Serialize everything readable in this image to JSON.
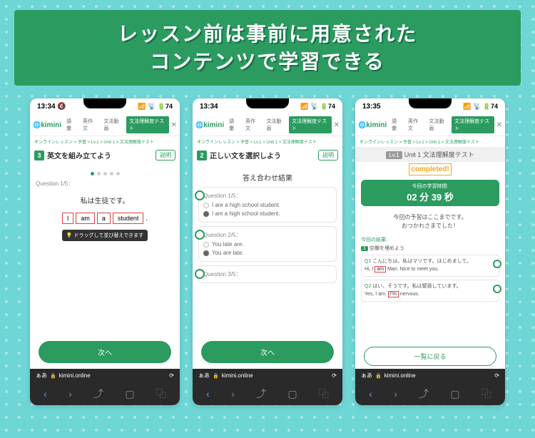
{
  "banner": {
    "line1": "レッスン前は事前に用意された",
    "line2": "コンテンツで学習できる"
  },
  "status": {
    "p1_time": "13:34 🔇",
    "p2_time": "13:34",
    "p3_time": "13:35",
    "icons": "📶 📡 🔋74"
  },
  "app": {
    "logo": "kimini",
    "tabs": [
      "語彙",
      "英作文",
      "文法動画",
      "文法理解度テスト"
    ],
    "close": "✕",
    "breadcrumb": "オンラインレッスン > 予習 > Lv.1 > Unit 1 > 文法理解度テスト"
  },
  "p1": {
    "num": "3",
    "title": "英文を組み立てよう",
    "explain": "説明",
    "qlabel": "Question 1/5：",
    "qtext": "私は生徒です。",
    "words": [
      "I",
      "am",
      "a",
      "student"
    ],
    "period": ".",
    "tip": "💡 ドラッグして並び替えできます",
    "next": "次へ"
  },
  "p2": {
    "num": "2",
    "title": "正しい文を選択しよう",
    "explain": "説明",
    "result_title": "答え合わせ結果",
    "q1_label": "Question 1/5：",
    "q1_opt1": "I are a high school student.",
    "q1_opt2": "I am a high school student.",
    "q2_label": "Question 2/5：",
    "q2_opt1": "You late are.",
    "q2_opt2": "You are late.",
    "q3_label": "Question 3/5：",
    "next": "次へ"
  },
  "p3": {
    "lv": "Lv.1",
    "lvtitle": "Unit 1 文法理解度テスト",
    "completed": "completed!",
    "timer_label": "今回の学習時間:",
    "timer_val": "02 分 39 秒",
    "msg1": "今回の予習はここまでです。",
    "msg2": "おつかれさまでした！",
    "reslabel": "今回の結果:",
    "s1_num": "1",
    "s1_title": "空欄を埋めよう",
    "q1_n": "Q1",
    "q1_jp": "こんにちは。私はマリです。はじめまして。",
    "q1_en_pre": "Hi, I",
    "q1_en_ans": "am",
    "q1_en_post": "Mari. Nice to meet you.",
    "q2_n": "Q2",
    "q2_jp": "はい、そうです。私は緊張しています。",
    "q2_en_pre": "Yes, I am.",
    "q2_en_ans": "I'm",
    "q2_en_post": "nervous.",
    "back": "一覧に戻る"
  },
  "browser": {
    "aa": "ぁあ",
    "lock": "🔒",
    "url": "kimini.online",
    "reload": "⟳"
  }
}
